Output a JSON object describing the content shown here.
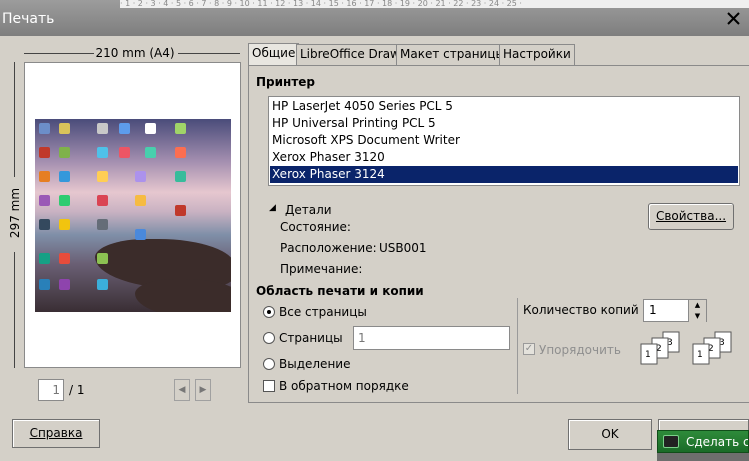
{
  "window": {
    "title": "Печать",
    "ruler_text": "· 1 · 2 · 3 · 4 · 5 · 6 · 7 · 8 · 9 · 10 · 11 · 12 · 13 · 14 · 15 · 16 · 17 · 18 · 19 · 20 · 21 · 22 · 23 · 24 · 25 ·"
  },
  "preview": {
    "width_label": "210 mm (A4)",
    "height_label": "297 mm",
    "current_page": "1",
    "total_pages": "/ 1"
  },
  "tabs": [
    {
      "label": "Общие"
    },
    {
      "label": "LibreOffice Draw"
    },
    {
      "label": "Макет страницы"
    },
    {
      "label": "Настройки"
    }
  ],
  "printer": {
    "section_title": "Принтер",
    "items": [
      {
        "label": "HP LaserJet 4050 Series PCL 5"
      },
      {
        "label": "HP Universal Printing PCL 5"
      },
      {
        "label": "Microsoft XPS Document Writer"
      },
      {
        "label": "Xerox Phaser 3120"
      },
      {
        "label": "Xerox Phaser 3124"
      }
    ],
    "details_label": "Детали",
    "status_label": "Состояние:",
    "location_label": "Расположение:",
    "location_value": "USB001",
    "comment_label": "Примечание:",
    "properties_button": "Свойства..."
  },
  "range": {
    "section_title": "Область печати и копии",
    "all_pages": "Все страницы",
    "pages": "Страницы",
    "pages_placeholder": "1",
    "selection": "Выделение",
    "reverse_order": "В обратном порядке",
    "copies_label": "Количество копий",
    "copies_value": "1",
    "collate_label": "Упорядочить",
    "collate_icon_numbers": [
      "1",
      "2",
      "3"
    ]
  },
  "buttons": {
    "help": "Справка",
    "ok": "OK",
    "screenshot": "Сделать снимок"
  }
}
